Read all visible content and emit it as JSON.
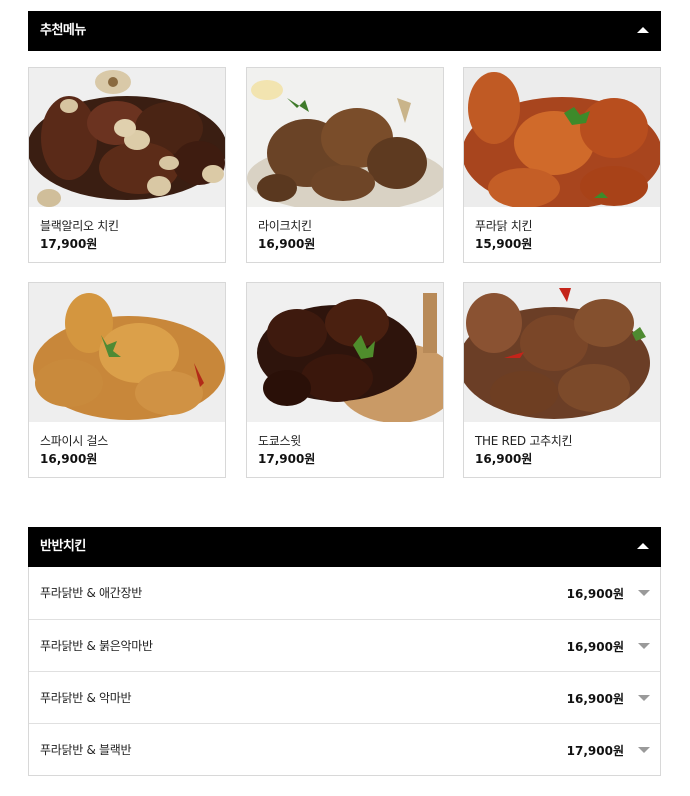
{
  "recommend": {
    "title": "추천메뉴",
    "items": [
      {
        "name": "블랙알리오 치킨",
        "price": "17,900원",
        "photo": "black-aglio-chicken-photo"
      },
      {
        "name": "라이크치킨",
        "price": "16,900원",
        "photo": "like-chicken-photo"
      },
      {
        "name": "푸라닭 치킨",
        "price": "15,900원",
        "photo": "puradak-chicken-photo"
      },
      {
        "name": "스파이시 걸스",
        "price": "16,900원",
        "photo": "spicy-girls-photo"
      },
      {
        "name": "도쿄스윗",
        "price": "17,900원",
        "photo": "tokyo-sweet-photo"
      },
      {
        "name": "THE RED 고추치킨",
        "price": "16,900원",
        "photo": "the-red-pepper-chicken-photo"
      }
    ]
  },
  "half": {
    "title": "반반치킨",
    "items": [
      {
        "name": "푸라닭반 & 애간장반",
        "price": "16,900원"
      },
      {
        "name": "푸라닭반 & 붉은악마반",
        "price": "16,900원"
      },
      {
        "name": "푸라닭반 & 악마반",
        "price": "16,900원"
      },
      {
        "name": "푸라닭반 & 블랙반",
        "price": "17,900원"
      }
    ]
  },
  "colors": {
    "header_bg": "#000000",
    "header_text": "#ffffff",
    "border": "#d8d8d8",
    "arrow": "#9a9a9a"
  }
}
